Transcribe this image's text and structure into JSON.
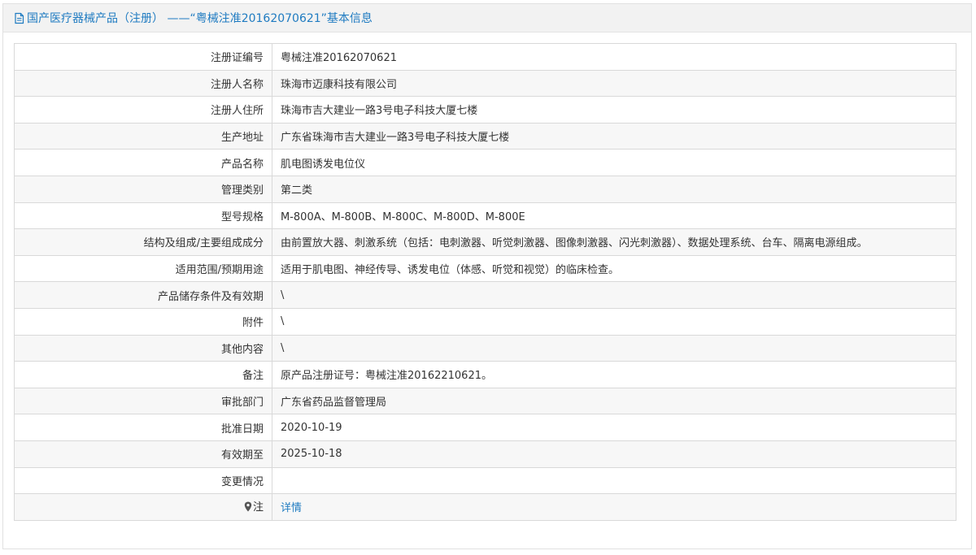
{
  "header": {
    "title": "国产医疗器械产品（注册） ——“粤械注准20162070621”基本信息"
  },
  "rows": [
    {
      "label": "注册证编号",
      "value": "粤械注准20162070621"
    },
    {
      "label": "注册人名称",
      "value": "珠海市迈康科技有限公司"
    },
    {
      "label": "注册人住所",
      "value": "珠海市吉大建业一路3号电子科技大厦七楼"
    },
    {
      "label": "生产地址",
      "value": "广东省珠海市吉大建业一路3号电子科技大厦七楼"
    },
    {
      "label": "产品名称",
      "value": "肌电图诱发电位仪"
    },
    {
      "label": "管理类别",
      "value": "第二类"
    },
    {
      "label": "型号规格",
      "value": "M-800A、M-800B、M-800C、M-800D、M-800E"
    },
    {
      "label": "结构及组成/主要组成成分",
      "value": "由前置放大器、刺激系统（包括：电刺激器、听觉刺激器、图像刺激器、闪光刺激器）、数据处理系统、台车、隔离电源组成。"
    },
    {
      "label": "适用范围/预期用途",
      "value": "适用于肌电图、神经传导、诱发电位（体感、听觉和视觉）的临床检查。"
    },
    {
      "label": "产品储存条件及有效期",
      "value": "\\"
    },
    {
      "label": "附件",
      "value": "\\"
    },
    {
      "label": "其他内容",
      "value": "\\"
    },
    {
      "label": "备注",
      "value": "原产品注册证号：粤械注准20162210621。"
    },
    {
      "label": "审批部门",
      "value": "广东省药品监督管理局"
    },
    {
      "label": "批准日期",
      "value": "2020-10-19"
    },
    {
      "label": "有效期至",
      "value": "2025-10-18"
    },
    {
      "label": "变更情况",
      "value": ""
    }
  ],
  "note": {
    "label": "注",
    "icon": "pin-icon",
    "link_text": "详情"
  },
  "colors": {
    "accent": "#1f7bc1",
    "header_bg": "#f2f2f2",
    "border": "#d9d9d9"
  }
}
